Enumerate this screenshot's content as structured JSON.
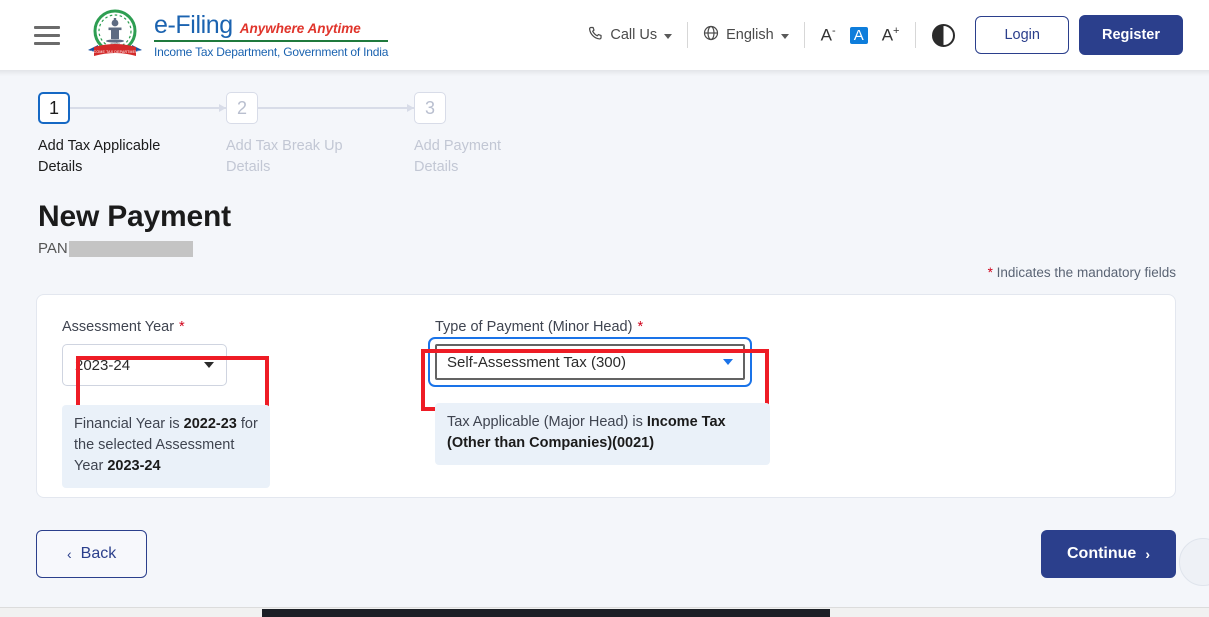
{
  "header": {
    "menu_icon": "hamburger-icon",
    "logo": {
      "title": "e-Filing",
      "tagline": "Anywhere Anytime",
      "subtitle": "Income Tax Department, Government of India",
      "emblem_ribbon": "INCOME TAX DEPARTMENT"
    },
    "call_us": "Call Us",
    "language": "English",
    "font_decrease": "A",
    "font_decrease_sup": "-",
    "font_normal": "A",
    "font_increase": "A",
    "font_increase_sup": "+",
    "contrast_icon": "contrast-icon",
    "login": "Login",
    "register": "Register"
  },
  "stepper": {
    "steps": [
      {
        "number": "1",
        "label": "Add Tax Applicable Details",
        "state": "active"
      },
      {
        "number": "2",
        "label": "Add Tax Break Up Details",
        "state": "inactive"
      },
      {
        "number": "3",
        "label": "Add Payment Details",
        "state": "inactive"
      }
    ]
  },
  "page": {
    "title": "New Payment",
    "pan_label": "PAN",
    "pan_value": "",
    "mandatory_star": "*",
    "mandatory_note": " Indicates the mandatory fields"
  },
  "form": {
    "assessment_year": {
      "label": "Assessment Year",
      "required_star": "*",
      "value": "2023-24",
      "hint_prefix": "Financial Year is ",
      "hint_fy": "2022-23",
      "hint_middle": " for the selected Assessment Year ",
      "hint_ay": "2023-24"
    },
    "minor_head": {
      "label": "Type of Payment (Minor Head)",
      "required_star": "*",
      "value": "Self-Assessment Tax (300)",
      "hint_prefix": "Tax Applicable (Major Head) is ",
      "hint_value": "Income Tax (Other than Companies)(0021)"
    }
  },
  "footer": {
    "back": "Back",
    "back_chevron": "‹",
    "continue": "Continue",
    "continue_chevron": "›"
  },
  "colors": {
    "brand_blue": "#1b63b0",
    "brand_navy": "#2b3f8c",
    "brand_green": "#1f7a3d",
    "brand_red": "#e0342b",
    "accent_focus": "#1a73e8",
    "annotation_red": "#ee1c25",
    "required_red": "#d0021b",
    "hint_bg": "#eaf1f9",
    "page_bg": "#f4f6fa"
  }
}
